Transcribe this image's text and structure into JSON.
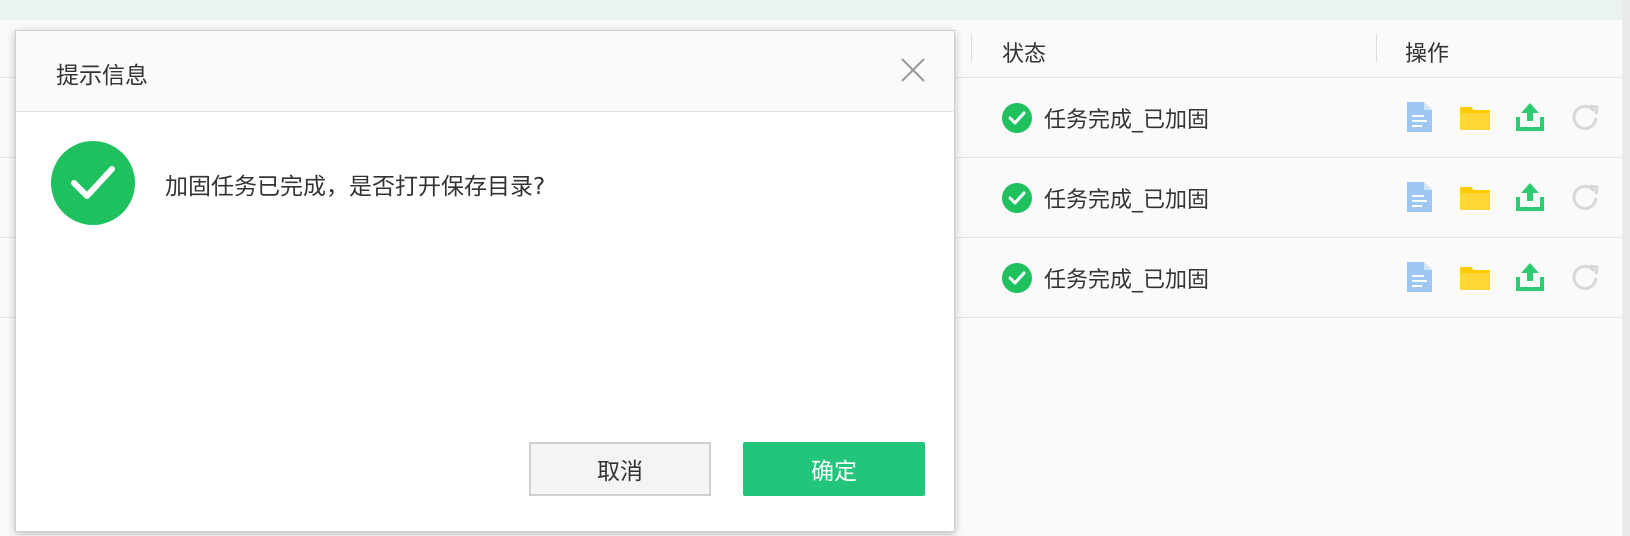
{
  "table": {
    "columns": {
      "status": "状态",
      "actions": "操作"
    },
    "rows": [
      {
        "status": "任务完成_已加固"
      },
      {
        "status": "任务完成_已加固"
      },
      {
        "status": "任务完成_已加固"
      }
    ],
    "action_icons": [
      "file-icon",
      "folder-icon",
      "upload-icon",
      "refresh-icon"
    ]
  },
  "dialog": {
    "title": "提示信息",
    "message": "加固任务已完成，是否打开保存目录?",
    "cancel_label": "取消",
    "confirm_label": "确定"
  },
  "colors": {
    "success_green": "#1ec15e",
    "confirm_button": "#22c57a",
    "file_blue": "#9ec6f3",
    "folder_yellow": "#ffcc00",
    "upload_green": "#2ecc71",
    "refresh_gray": "#d8d8d8"
  }
}
